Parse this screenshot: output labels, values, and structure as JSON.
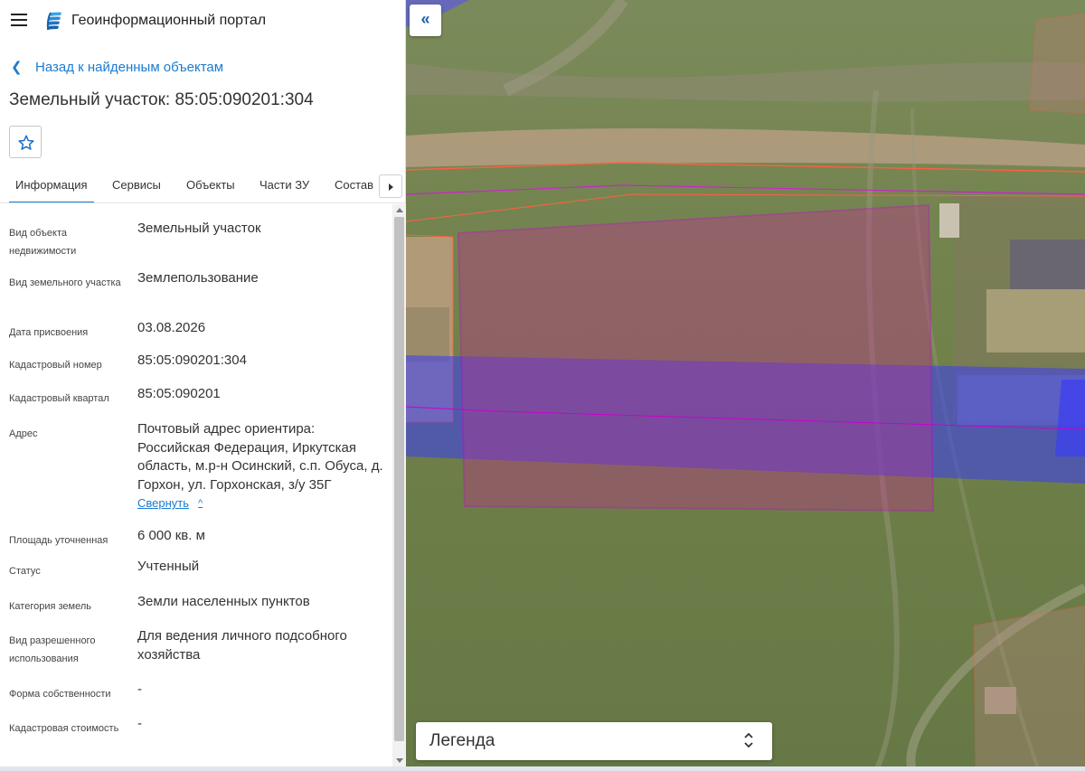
{
  "app": {
    "title": "Геоинформационный портал"
  },
  "nav": {
    "back_label": "Назад к найденным объектам"
  },
  "object": {
    "title": "Земельный участок: 85:05:090201:304"
  },
  "tabs": [
    {
      "label": "Информация",
      "active": true
    },
    {
      "label": "Сервисы"
    },
    {
      "label": "Объекты"
    },
    {
      "label": "Части ЗУ"
    },
    {
      "label": "Состав"
    }
  ],
  "fields": [
    {
      "key": "Вид объекта недвижимости",
      "value": "Земельный участок"
    },
    {
      "key": "Вид земельного участка",
      "value": "Землепользование"
    },
    {
      "key": "Дата присвоения",
      "value": "03.08.2026"
    },
    {
      "key": "Кадастровый номер",
      "value": "85:05:090201:304"
    },
    {
      "key": "Кадастровый квартал",
      "value": "85:05:090201"
    },
    {
      "key": "Адрес",
      "value": "Почтовый адрес ориентира: Российская Федерация, Иркутская область, м.р-н Осинский, с.п. Обуса, д. Горхон, ул. Горхонская, з/у 35Г",
      "action": "Свернуть"
    },
    {
      "key": "Площадь уточненная",
      "value": "6 000 кв. м"
    },
    {
      "key": "Статус",
      "value": "Учтенный"
    },
    {
      "key": "Категория земель",
      "value": "Земли населенных пунктов"
    },
    {
      "key": "Вид разрешенного использования",
      "value": "Для ведения личного подсобного хозяйства"
    },
    {
      "key": "Форма собственности",
      "value": "-"
    },
    {
      "key": "Кадастровая стоимость",
      "value": "-"
    }
  ],
  "map": {
    "collapse_icon": "double-chevron-left-icon",
    "legend_label": "Легенда",
    "colors": {
      "parcel_fill": "#c0308f",
      "parcel_border": "#cc00cc",
      "zone_fill": "#3b3df5",
      "road_border": "#ff4a4a"
    }
  },
  "icons": {
    "menu": "hamburger-menu-icon",
    "logo": "portal-logo-icon",
    "favorite": "star-outline-icon",
    "tabs_scroll": "chevron-right-icon"
  }
}
